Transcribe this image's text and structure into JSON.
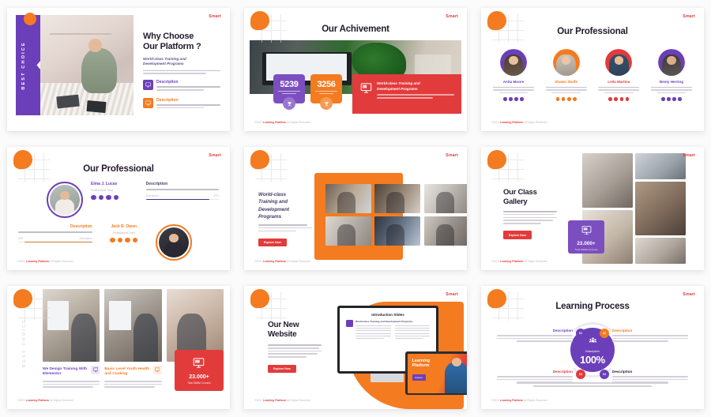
{
  "brand": "Smart",
  "footer": {
    "copy": "©2021",
    "name": "Learning Platform",
    "rights": "All Rights Reserved"
  },
  "slides": [
    {
      "id": "why-choose-our-platform",
      "badge": "BEST CHOICE",
      "heading": "Why Choose\nOur Platform ?",
      "subheading": "World-class Training and\nDevelopment Programs",
      "features": [
        {
          "title": "Description",
          "color": "#6C3FBA",
          "icon": "monitor-icon"
        },
        {
          "title": "Description",
          "color": "#F47B20",
          "icon": "monitor-icon"
        }
      ]
    },
    {
      "id": "our-achievement",
      "title": "Our Achivement",
      "stats": [
        {
          "value": "5239",
          "color": "#7C4FC0",
          "icon": "trophy-icon"
        },
        {
          "value": "3256",
          "color": "#F47B20",
          "icon": "trophy-icon"
        }
      ],
      "callout": {
        "title": "World-class Training and\nDevelopment Programs",
        "color": "#E23B3B",
        "icon": "monitor-icon"
      }
    },
    {
      "id": "our-professional-team",
      "title": "Our Professional",
      "members": [
        {
          "name": "Anita Moore",
          "color": "#6C3FBA"
        },
        {
          "name": "Shawn Stolfs",
          "color": "#F47B20"
        },
        {
          "name": "Leila Martina",
          "color": "#E23B3B"
        },
        {
          "name": "Besty Herring",
          "color": "#6C3FBA"
        }
      ]
    },
    {
      "id": "our-professional-detail",
      "title": "Our Professional",
      "people": [
        {
          "name": "Elma J. Lucas",
          "role": "Professional Tutor",
          "color": "#6C3FBA",
          "desc_title": "Description",
          "bar_label": "Description",
          "bar_value": "87%",
          "bar_pct": 87
        },
        {
          "name": "Jack R. Owen",
          "role": "Professional Tutor",
          "color": "#F47B20",
          "desc_title": "Description",
          "bar_label": "Description",
          "bar_value": "92%",
          "bar_pct": 92
        }
      ]
    },
    {
      "id": "world-class-training",
      "heading": "World-class\nTraining and\nDevelopment\nPrograms",
      "cta": "Explore Now"
    },
    {
      "id": "our-class-gallery",
      "heading": "Our Class\nGallery",
      "cta": "Explore Now",
      "badge": {
        "value": "23.000+",
        "label": "Total Skillful Courses",
        "color": "#7C4FC0",
        "icon": "monitor-icon"
      }
    },
    {
      "id": "course-highlights",
      "badge": "BEST CHOICE",
      "courses": [
        {
          "title": "We Design Training\nWith Elementor",
          "color": "#6C3FBA",
          "icon": "monitor-icon"
        },
        {
          "title": "Basic Level Youth\nHealth and Cooking",
          "color": "#F47B20",
          "icon": "monitor-icon"
        }
      ],
      "badge_card": {
        "value": "23.000+",
        "label": "Total Skillful Courses",
        "color": "#E23B3B",
        "icon": "monitor-icon"
      }
    },
    {
      "id": "our-new-website",
      "heading": "Our New\nWebsite",
      "cta": "Explore Now",
      "mockup": {
        "screen_title": "Introduction Slides",
        "screen_sub": "World-class Training and Development Programs",
        "laptop_title": "Learning\nPlatform",
        "laptop_btn": "Explore"
      }
    },
    {
      "id": "learning-process",
      "title": "Learning Process",
      "center": {
        "label": "Description",
        "value": "100%",
        "color": "#6C3FBA",
        "icon": "group-icon"
      },
      "steps": [
        {
          "num": "01",
          "title": "Description",
          "color": "#6C3FBA"
        },
        {
          "num": "02",
          "title": "Description",
          "color": "#F47B20"
        },
        {
          "num": "03",
          "title": "Description",
          "color": "#E23B3B"
        },
        {
          "num": "04",
          "title": "Description",
          "color": "#6C3FBA"
        }
      ]
    }
  ]
}
